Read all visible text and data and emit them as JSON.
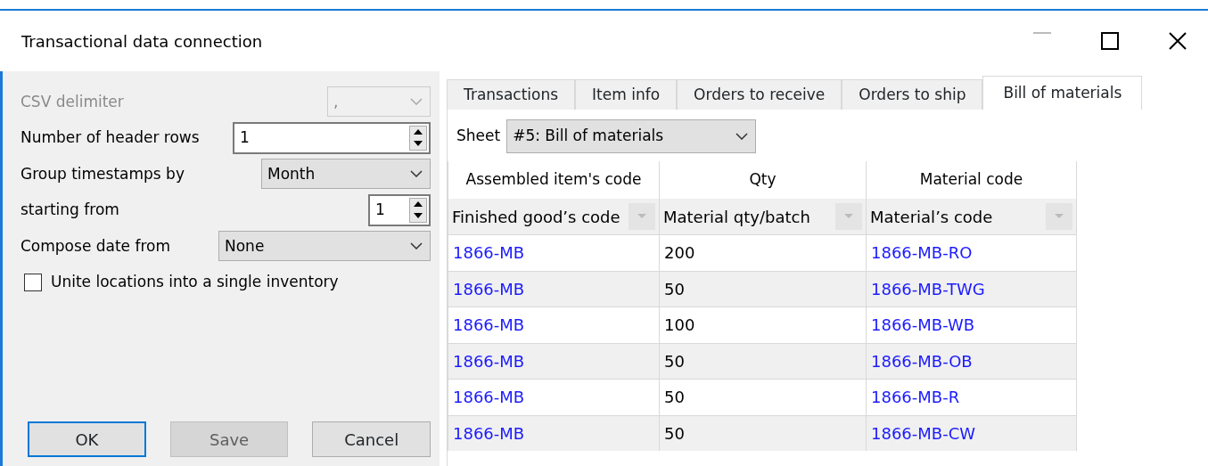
{
  "window": {
    "title": "Transactional data connection"
  },
  "settings": [
    {
      "kind": "select",
      "label": "CSV delimiter",
      "value": ",",
      "disabled": true
    },
    {
      "kind": "spin",
      "label": "Number of header rows",
      "value": "1",
      "disabled": false
    },
    {
      "kind": "select",
      "label": "Group timestamps by",
      "value": "Month",
      "disabled": false
    },
    {
      "kind": "spin-small",
      "label": "starting from",
      "value": "1",
      "disabled": false
    },
    {
      "kind": "select",
      "label": "Compose date from",
      "value": "None",
      "disabled": false
    },
    {
      "kind": "checkbox",
      "label": "Unite locations into a single inventory",
      "checked": false
    }
  ],
  "buttons": [
    {
      "label": "OK",
      "default": true,
      "disabled": false
    },
    {
      "label": "Save",
      "default": false,
      "disabled": true
    },
    {
      "label": "Cancel",
      "default": false,
      "disabled": false
    }
  ],
  "tabs": [
    {
      "label": "Transactions",
      "selected": false
    },
    {
      "label": "Item info",
      "selected": false
    },
    {
      "label": "Orders to receive",
      "selected": false
    },
    {
      "label": "Orders to ship",
      "selected": false
    },
    {
      "label": "Bill of materials",
      "selected": true
    }
  ],
  "sheet": {
    "label": "Sheet",
    "value": "#5: Bill of materials"
  },
  "table": {
    "columns": [
      {
        "field": "Assembled item's code",
        "source": "Finished good’s code"
      },
      {
        "field": "Qty",
        "source": "Material qty/batch"
      },
      {
        "field": "Material code",
        "source": "Material’s code"
      }
    ],
    "rows": [
      [
        "1866-MB",
        "200",
        "1866-MB-RO"
      ],
      [
        "1866-MB",
        "50",
        "1866-MB-TWG"
      ],
      [
        "1866-MB",
        "100",
        "1866-MB-WB"
      ],
      [
        "1866-MB",
        "50",
        "1866-MB-OB"
      ],
      [
        "1866-MB",
        "50",
        "1866-MB-R"
      ],
      [
        "1866-MB",
        "50",
        "1866-MB-CW"
      ]
    ]
  }
}
